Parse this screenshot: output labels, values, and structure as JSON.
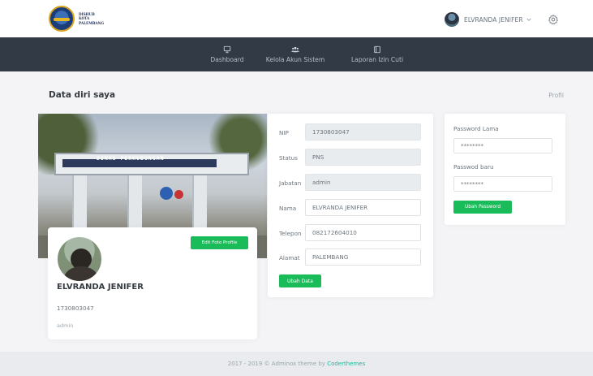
{
  "logo": {
    "line1": "DISHUB",
    "line2": "KOTA",
    "line3": "PALEMBANG"
  },
  "user": {
    "name": "ELVRANDA JENIFER"
  },
  "nav": [
    {
      "label": "Dashboard",
      "icon": "monitor-icon"
    },
    {
      "label": "Kelola Akun Sistem",
      "icon": "users-icon"
    },
    {
      "label": "Laporan Izin Cuti",
      "icon": "book-icon"
    }
  ],
  "page": {
    "title": "Data diri saya",
    "breadcrumb": "Profil"
  },
  "photo": {
    "sign": "DINAS PERHUBUNGAN"
  },
  "profile": {
    "name": "ELVRANDA JENIFER",
    "nip": "1730803047",
    "role": "admin",
    "edit_label": "Edit Foto Profile"
  },
  "form": {
    "nip_label": "NIP",
    "nip": "1730803047",
    "status_label": "Status",
    "status": "PNS",
    "jabatan_label": "Jabatan",
    "jabatan": "admin",
    "nama_label": "Nama",
    "nama": "ELVRANDA JENIFER",
    "telepon_label": "Telepon",
    "telepon": "082172604010",
    "alamat_label": "Alamat",
    "alamat": "PALEMBANG",
    "submit_label": "Ubah Data"
  },
  "password": {
    "old_label": "Password Lama",
    "old_placeholder": "********",
    "new_label": "Passwod baru",
    "new_placeholder": "********",
    "submit_label": "Ubah Password"
  },
  "footer": {
    "text": "2017 - 2019 © Adminox theme by ",
    "link": "Coderthemes"
  },
  "colors": {
    "navbar": "#323a46",
    "accent_green": "#1abc5a",
    "footer_link": "#1abc9c"
  }
}
